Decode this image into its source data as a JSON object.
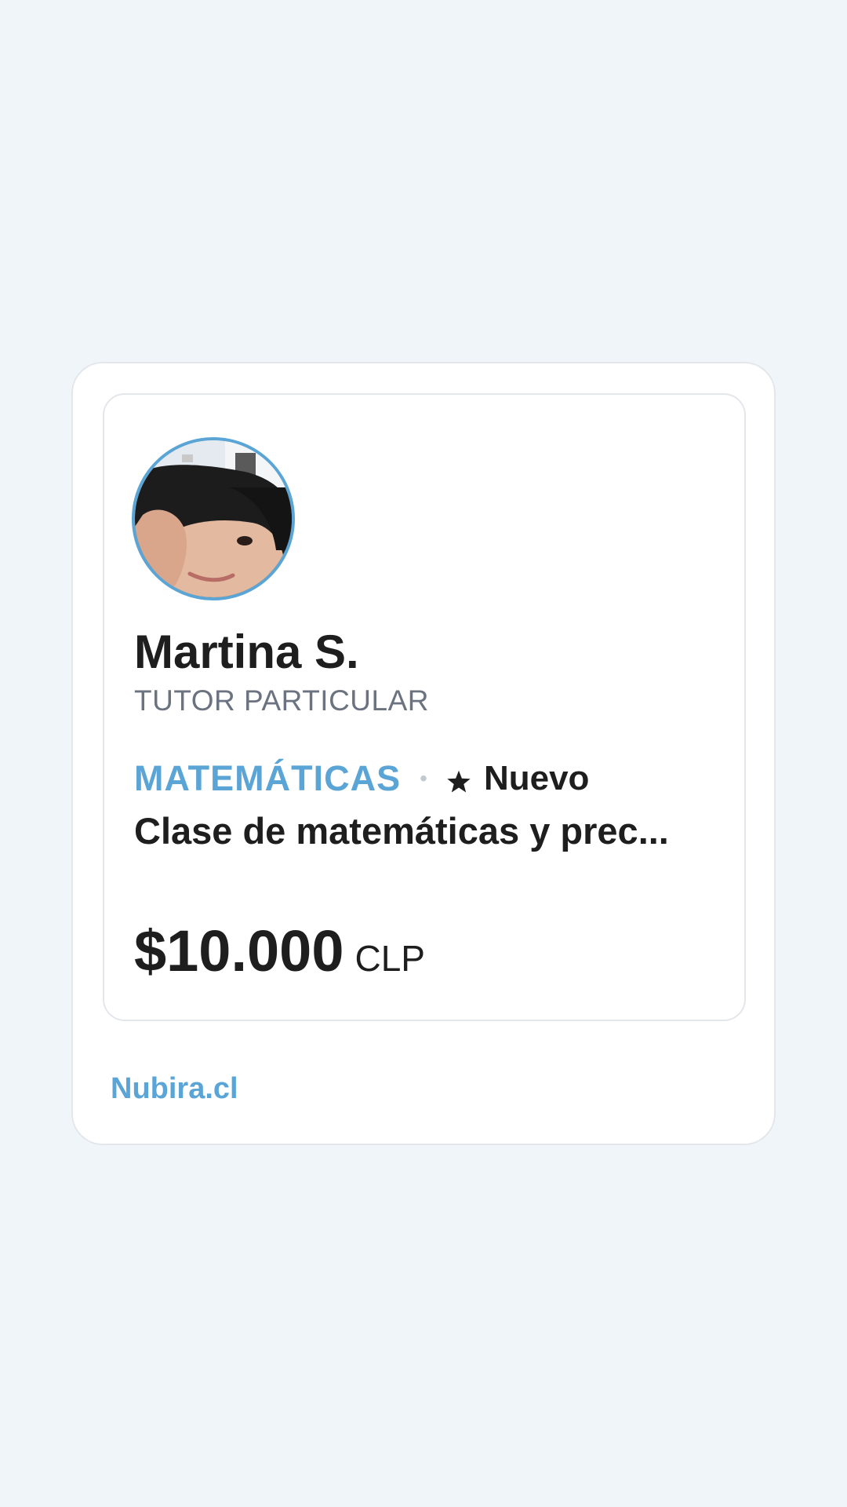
{
  "tutor": {
    "name": "Martina S.",
    "role": "TUTOR PARTICULAR",
    "subject": "MATEMÁTICAS",
    "separator": "•",
    "badge": "Nuevo",
    "badge_icon": "star-icon",
    "description": "Clase de matemáticas y prec...",
    "price": "$10.000",
    "currency": "CLP",
    "avatar_alt": "Martina S."
  },
  "footer": {
    "brand": "Nubira.cl"
  },
  "colors": {
    "background": "#f0f5f9",
    "accent": "#5aa5d6",
    "text": "#1e1e1e",
    "muted": "#6b7280",
    "border": "#e3e6ea"
  }
}
